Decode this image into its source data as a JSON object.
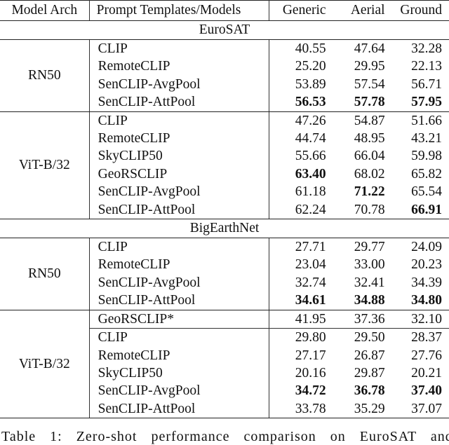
{
  "table": {
    "headers": [
      "Model Arch",
      "Prompt Templates/Models",
      "Generic",
      "Aerial",
      "Ground"
    ],
    "sections": [
      {
        "title": "EuroSAT",
        "groups": [
          {
            "arch": "RN50",
            "rows": [
              {
                "model": "CLIP",
                "generic": "40.55",
                "aerial": "47.64",
                "ground": "32.28",
                "bold": []
              },
              {
                "model": "RemoteCLIP",
                "generic": "25.20",
                "aerial": "29.95",
                "ground": "22.13",
                "bold": []
              },
              {
                "model": "SenCLIP-AvgPool",
                "generic": "53.89",
                "aerial": "57.54",
                "ground": "56.71",
                "bold": []
              },
              {
                "model": "SenCLIP-AttPool",
                "generic": "56.53",
                "aerial": "57.78",
                "ground": "57.95",
                "bold": [
                  "generic",
                  "aerial",
                  "ground"
                ]
              }
            ]
          },
          {
            "arch": "ViT-B/32",
            "rows": [
              {
                "model": "CLIP",
                "generic": "47.26",
                "aerial": "54.87",
                "ground": "51.66",
                "bold": []
              },
              {
                "model": "RemoteCLIP",
                "generic": "44.74",
                "aerial": "48.95",
                "ground": "43.21",
                "bold": []
              },
              {
                "model": "SkyCLIP50",
                "generic": "55.66",
                "aerial": "66.04",
                "ground": "59.98",
                "bold": []
              },
              {
                "model": "GeoRSCLIP",
                "generic": "63.40",
                "aerial": "68.02",
                "ground": "65.82",
                "bold": [
                  "generic"
                ]
              },
              {
                "model": "SenCLIP-AvgPool",
                "generic": "61.18",
                "aerial": "71.22",
                "ground": "65.54",
                "bold": [
                  "aerial"
                ]
              },
              {
                "model": "SenCLIP-AttPool",
                "generic": "62.24",
                "aerial": "70.78",
                "ground": "66.91",
                "bold": [
                  "ground"
                ]
              }
            ]
          }
        ]
      },
      {
        "title": "BigEarthNet",
        "groups": [
          {
            "arch": "RN50",
            "rows": [
              {
                "model": "CLIP",
                "generic": "27.71",
                "aerial": "29.77",
                "ground": "24.09",
                "bold": []
              },
              {
                "model": "RemoteCLIP",
                "generic": "23.04",
                "aerial": "33.00",
                "ground": "20.23",
                "bold": []
              },
              {
                "model": "SenCLIP-AvgPool",
                "generic": "32.74",
                "aerial": "32.41",
                "ground": "34.39",
                "bold": []
              },
              {
                "model": "SenCLIP-AttPool",
                "generic": "34.61",
                "aerial": "34.88",
                "ground": "34.80",
                "bold": [
                  "generic",
                  "aerial",
                  "ground"
                ]
              }
            ]
          },
          {
            "arch": "ViT-B/32",
            "rows": [
              {
                "model": "GeoRSCLIP*",
                "generic": "41.95",
                "aerial": "37.36",
                "ground": "32.10",
                "bold": [],
                "separator_after": true
              },
              {
                "model": "CLIP",
                "generic": "29.80",
                "aerial": "29.50",
                "ground": "28.37",
                "bold": []
              },
              {
                "model": "RemoteCLIP",
                "generic": "27.17",
                "aerial": "26.87",
                "ground": "27.76",
                "bold": []
              },
              {
                "model": "SkyCLIP50",
                "generic": "20.16",
                "aerial": "29.87",
                "ground": "20.21",
                "bold": []
              },
              {
                "model": "SenCLIP-AvgPool",
                "generic": "34.72",
                "aerial": "36.78",
                "ground": "37.40",
                "bold": [
                  "generic",
                  "aerial",
                  "ground"
                ]
              },
              {
                "model": "SenCLIP-AttPool",
                "generic": "33.78",
                "aerial": "35.29",
                "ground": "37.07",
                "bold": []
              }
            ]
          }
        ]
      }
    ]
  },
  "caption": "Table 1: Zero-shot performance comparison on EuroSAT and"
}
